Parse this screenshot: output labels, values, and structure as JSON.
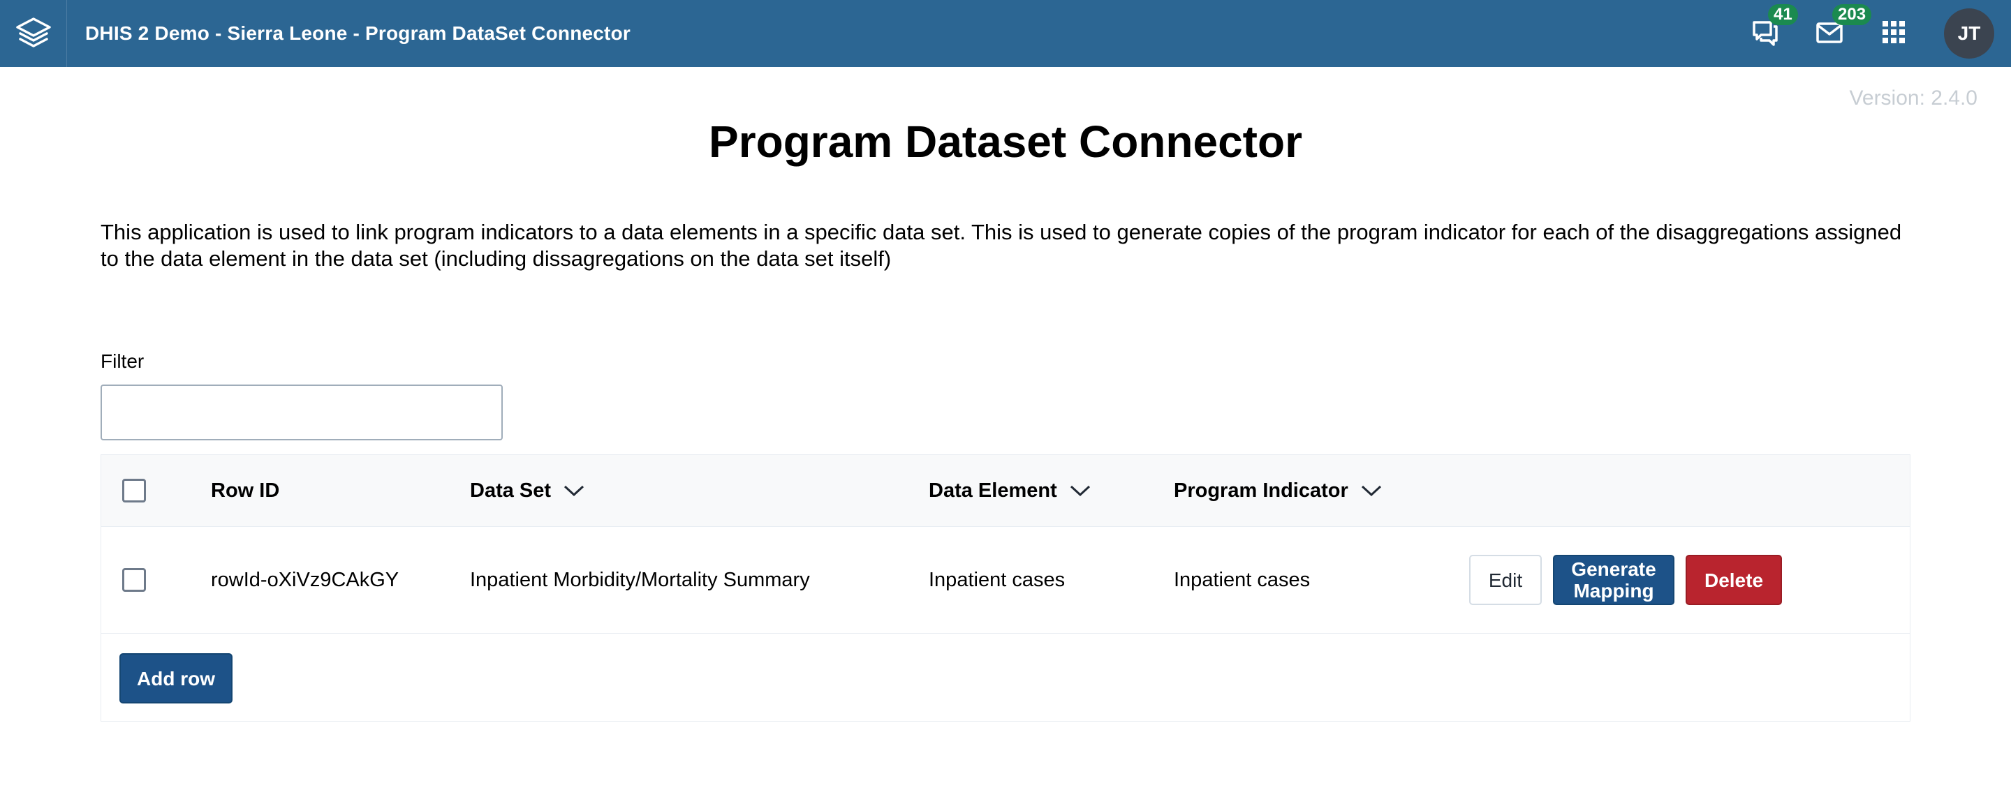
{
  "header": {
    "title": "DHIS 2 Demo - Sierra Leone - Program DataSet Connector",
    "interpretations_count": "41",
    "messages_count": "203",
    "user_initials": "JT",
    "icons": [
      "dhis2-logo-icon",
      "interpretations-icon",
      "messages-icon",
      "apps-grid-icon"
    ]
  },
  "version": "Version: 2.4.0",
  "page": {
    "title": "Program Dataset Connector",
    "description": "This application is used to link program indicators to a data elements in a specific data set. This is used to generate copies of the program indicator for each of the disaggregations assigned to the data element in the data set (including dissagregations on the data set itself)"
  },
  "filter": {
    "label": "Filter",
    "value": "",
    "placeholder": ""
  },
  "table": {
    "columns": {
      "row_id": "Row ID",
      "data_set": "Data Set",
      "data_element": "Data Element",
      "program_indicator": "Program Indicator"
    },
    "rows": [
      {
        "row_id": "rowId-oXiVz9CAkGY",
        "data_set": "Inpatient Morbidity/Mortality Summary",
        "data_element": "Inpatient cases",
        "program_indicator": "Inpatient cases",
        "actions": {
          "edit": "Edit",
          "generate": "Generate Mapping",
          "delete": "Delete"
        }
      }
    ],
    "add_row_label": "Add row"
  },
  "colors": {
    "header_bg": "#2c6693",
    "badge_green": "#1b8a4f",
    "primary_blue": "#1d5288",
    "destructive_red": "#b9242e"
  }
}
